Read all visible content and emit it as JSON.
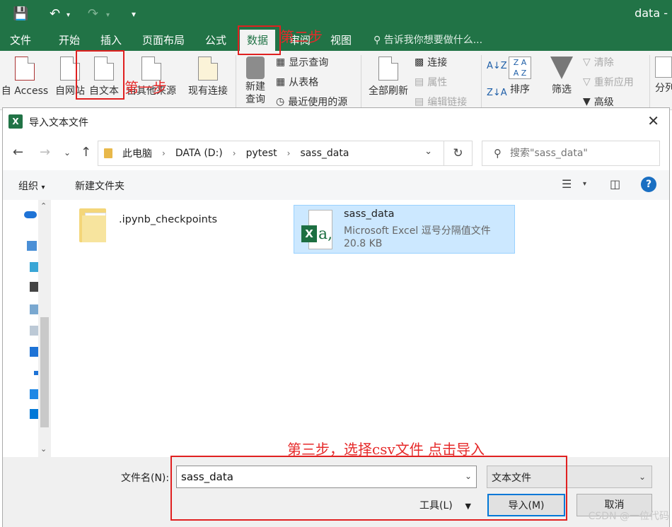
{
  "excel": {
    "title": "data -",
    "quick_access": {
      "save": "save-icon",
      "undo": "undo-icon",
      "redo": "redo-icon",
      "customize": "customize-icon"
    },
    "tabs": [
      "文件",
      "开始",
      "插入",
      "页面布局",
      "公式",
      "数据",
      "审阅",
      "视图"
    ],
    "tell_me": "告诉我你想要做什么...",
    "ribbon": {
      "from_access": "自 Access",
      "from_web": "自网站",
      "from_text": "自文本",
      "from_other": "自其他来源",
      "existing_connections": "现有连接",
      "new_query": "新建\n查询",
      "show_queries": "显示查询",
      "from_table": "从表格",
      "recent_sources": "最近使用的源",
      "refresh_all": "全部刷新",
      "connections": "连接",
      "properties": "属性",
      "edit_links": "编辑链接",
      "sort": "排序",
      "filter": "筛选",
      "clear": "清除",
      "reapply": "重新应用",
      "advanced": "高级",
      "split": "分列"
    }
  },
  "annotations": {
    "step1": "第一步",
    "step2": "第二步",
    "step3": "第三步，选择csv文件 点击导入"
  },
  "dialog": {
    "title": "导入文本文件",
    "breadcrumb": [
      "此电脑",
      "DATA (D:)",
      "pytest",
      "sass_data"
    ],
    "search_placeholder": "搜索\"sass_data\"",
    "organize": "组织",
    "new_folder": "新建文件夹",
    "files": [
      {
        "name": ".ipynb_checkpoints",
        "kind": "folder"
      },
      {
        "name": "sass_data",
        "type": "Microsoft Excel 逗号分隔值文件",
        "size": "20.8 KB",
        "kind": "csv",
        "selected": true
      }
    ],
    "filename_label": "文件名(N):",
    "filename_value": "sass_data",
    "filetype": "文本文件",
    "tools": "工具(L)",
    "import_button": "导入(M)",
    "cancel_button": "取消"
  },
  "watermark": "CSDN @一位代码"
}
